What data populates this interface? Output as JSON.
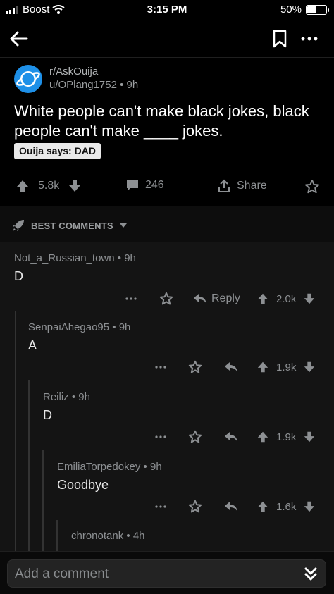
{
  "status_bar": {
    "carrier": "Boost",
    "time": "3:15 PM",
    "battery": "50%",
    "battery_level": 0.5
  },
  "nav": {
    "back_icon": "arrow-left-icon",
    "save_icon": "bookmark-icon",
    "more_icon": "more-dots-icon"
  },
  "post": {
    "subreddit": "r/AskOuija",
    "author": "u/OPlang1752",
    "age": "9h",
    "title": "White people can't make black jokes, black people can't make ____ jokes.",
    "flair": "Ouija says: DAD",
    "votes": "5.8k",
    "comments": "246",
    "share_label": "Share"
  },
  "sort": {
    "label": "BEST COMMENTS"
  },
  "comments": [
    {
      "author": "Not_a_Russian_town",
      "age": "9h",
      "body": "D",
      "reply_label": "Reply",
      "votes": "2.0k",
      "depth": 0
    },
    {
      "author": "SenpaiAhegao95",
      "age": "9h",
      "body": "A",
      "votes": "1.9k",
      "depth": 1
    },
    {
      "author": "Reiliz",
      "age": "9h",
      "body": "D",
      "votes": "1.9k",
      "depth": 2
    },
    {
      "author": "EmiliaTorpedokey",
      "age": "9h",
      "body": "Goodbye",
      "votes": "1.6k",
      "depth": 3
    },
    {
      "author": "chronotank",
      "age": "4h",
      "depth": 4
    }
  ],
  "comment_bar": {
    "placeholder": "Add a comment"
  },
  "colors": {
    "background": "#000000",
    "comments_background": "#141414",
    "text": "#d7dadc",
    "muted": "#8d9093",
    "subreddit_icon": "#1e90e8"
  }
}
